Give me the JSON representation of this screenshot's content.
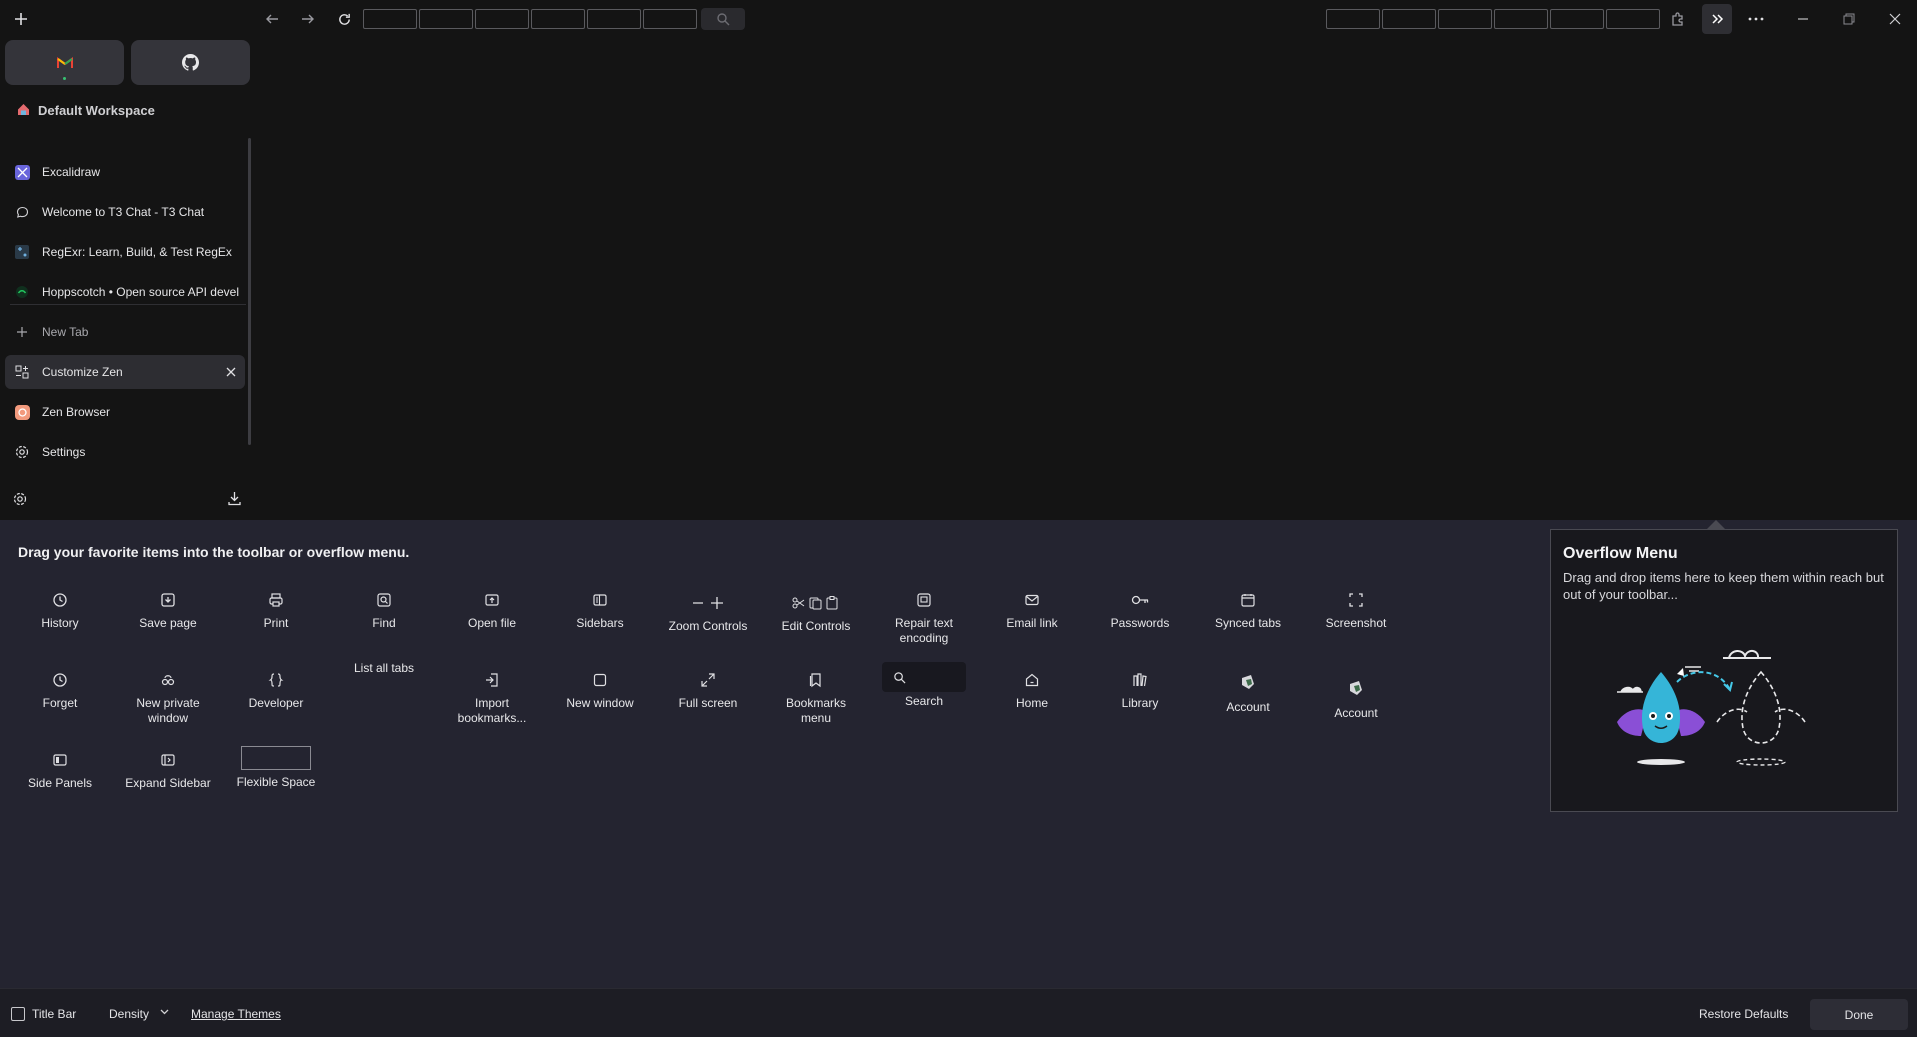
{
  "toolbar": {
    "new_tab_icon": "plus-icon",
    "back_icon": "arrow-left-icon",
    "forward_icon": "arrow-right-icon",
    "reload_icon": "reload-icon",
    "search_icon": "search-icon",
    "extensions_icon": "puzzle-icon",
    "overflow_icon": "chevrons-right-icon",
    "menu_icon": "more-icon",
    "window_controls": [
      "minimize-icon",
      "restore-icon",
      "close-icon"
    ]
  },
  "sidebar": {
    "essentials": [
      {
        "name": "Gmail",
        "icon": "gmail-icon"
      },
      {
        "name": "GitHub",
        "icon": "github-icon"
      }
    ],
    "workspace_title": "Default Workspace",
    "tabs": [
      {
        "label": "Excalidraw",
        "icon": "excalidraw-icon"
      },
      {
        "label": "Welcome to T3 Chat - T3 Chat",
        "icon": "chat-icon"
      },
      {
        "label": "RegExr: Learn, Build, & Test RegEx",
        "icon": "regexr-icon"
      },
      {
        "label": "Hoppscotch • Open source API devel",
        "icon": "hoppscotch-icon"
      }
    ],
    "new_tab_label": "New Tab",
    "pinned_tabs": [
      {
        "label": "Customize Zen",
        "icon": "customize-icon",
        "active": true
      },
      {
        "label": "Zen Browser",
        "icon": "zen-icon"
      },
      {
        "label": "Settings",
        "icon": "gear-icon"
      }
    ]
  },
  "panel": {
    "heading": "Drag your favorite items into the toolbar or overflow menu.",
    "items_row1": [
      {
        "label": "History",
        "icon": "history-icon"
      },
      {
        "label": "Save page",
        "icon": "save-page-icon"
      },
      {
        "label": "Print",
        "icon": "print-icon"
      },
      {
        "label": "Find",
        "icon": "find-icon"
      },
      {
        "label": "Open file",
        "icon": "open-file-icon"
      },
      {
        "label": "Sidebars",
        "icon": "sidebars-icon"
      },
      {
        "label": "Zoom Controls",
        "icon": "zoom-controls-icon"
      },
      {
        "label": "Edit Controls",
        "icon": "edit-controls-icon"
      },
      {
        "label": "Repair text encoding",
        "icon": "repair-encoding-icon"
      },
      {
        "label": "Email link",
        "icon": "email-icon"
      },
      {
        "label": "Passwords",
        "icon": "key-icon"
      },
      {
        "label": "Synced tabs",
        "icon": "synced-tabs-icon"
      },
      {
        "label": "Screenshot",
        "icon": "screenshot-icon"
      }
    ],
    "items_row2": [
      {
        "label": "Forget",
        "icon": "forget-icon"
      },
      {
        "label": "New private window",
        "icon": "private-window-icon"
      },
      {
        "label": "Developer",
        "icon": "developer-icon"
      },
      {
        "label": "List all tabs",
        "icon": ""
      },
      {
        "label": "Import bookmarks...",
        "icon": "import-icon"
      },
      {
        "label": "New window",
        "icon": "new-window-icon"
      },
      {
        "label": "Full screen",
        "icon": "fullscreen-icon"
      },
      {
        "label": "Bookmarks menu",
        "icon": "bookmarks-icon"
      },
      {
        "label": "Search",
        "icon": "search-icon"
      },
      {
        "label": "Home",
        "icon": "home-icon"
      },
      {
        "label": "Library",
        "icon": "library-icon"
      },
      {
        "label": "Account",
        "icon": "account-icon"
      },
      {
        "label": "Account",
        "icon": "account-icon"
      }
    ],
    "items_row3": [
      {
        "label": "Side Panels",
        "icon": "side-panels-icon"
      },
      {
        "label": "Expand Sidebar",
        "icon": "expand-sidebar-icon"
      },
      {
        "label": "Flexible Space",
        "icon": "flexible-space"
      }
    ]
  },
  "overflow_menu": {
    "title": "Overflow Menu",
    "description": "Drag and drop items here to keep them within reach but out of your toolbar..."
  },
  "bottom": {
    "title_bar_label": "Title Bar",
    "density_label": "Density",
    "manage_themes_label": "Manage Themes",
    "restore_defaults_label": "Restore Defaults",
    "done_label": "Done"
  }
}
